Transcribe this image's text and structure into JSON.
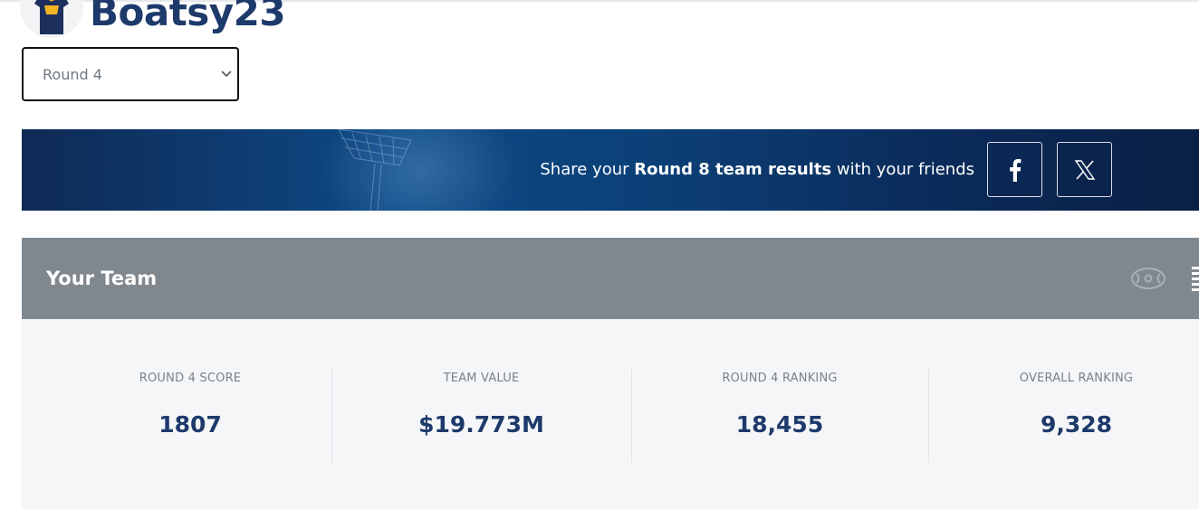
{
  "profile": {
    "username": "Boatsy23",
    "avatar_icon": "team-guernsey-icon"
  },
  "round_select": {
    "selected": "Round 4",
    "icon": "chevron-down-icon"
  },
  "banner": {
    "share_prefix": "Share your ",
    "share_bold": "Round 8 team results",
    "share_suffix": " with your friends",
    "facebook_icon": "facebook-icon",
    "x_icon": "x-icon"
  },
  "team": {
    "title": "Your Team",
    "field_icon": "field-view-icon",
    "stats": [
      {
        "label": "ROUND 4 SCORE",
        "value": "1807"
      },
      {
        "label": "TEAM VALUE",
        "value": "$19.773M"
      },
      {
        "label": "ROUND 4 RANKING",
        "value": "18,455"
      },
      {
        "label": "OVERALL RANKING",
        "value": "9,328"
      }
    ]
  },
  "colors": {
    "brand_navy": "#1d3a6b",
    "header_grey": "#80888f",
    "stats_bg": "#f5f6f8"
  }
}
